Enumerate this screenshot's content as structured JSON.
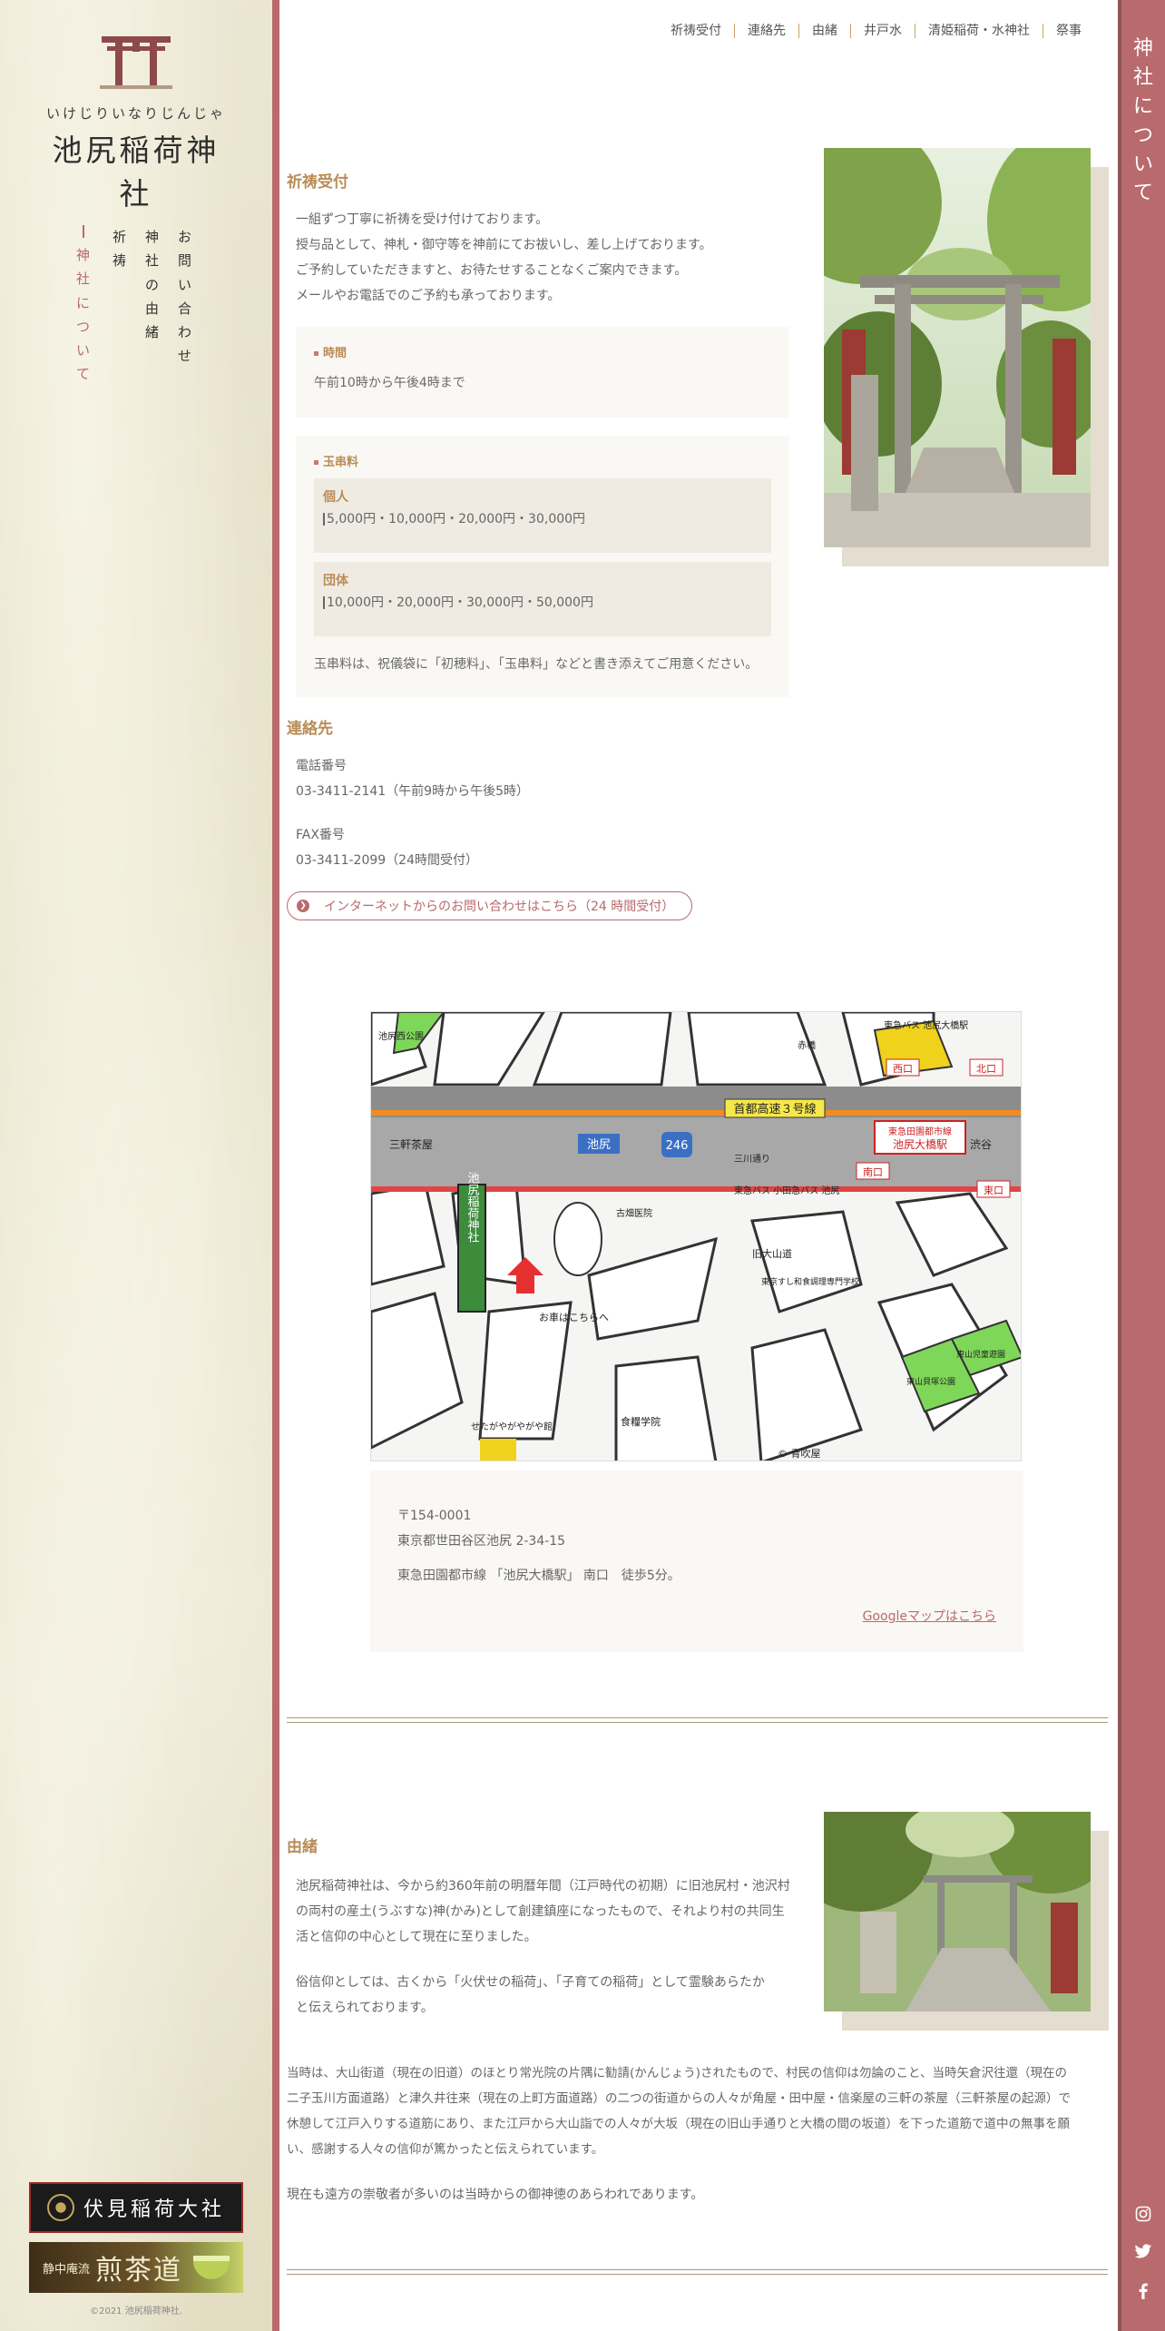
{
  "site": {
    "kana": "いけじりいなりじんじゃ",
    "name": "池尻稲荷神社",
    "copyright": "©2021 池尻稲荷神社."
  },
  "side_nav": [
    {
      "label": "お問い合わせ"
    },
    {
      "label": "神社の由緒"
    },
    {
      "label": "祈祷"
    },
    {
      "label": "神社について"
    }
  ],
  "banners": {
    "fushimi": "伏見稲荷大社",
    "sencha_small": "静中庵流",
    "sencha_big": "煎茶道"
  },
  "right_bar": {
    "title": "神社について"
  },
  "social": {
    "instagram": "instagram-icon",
    "twitter": "twitter-icon",
    "facebook": "facebook-icon"
  },
  "top_nav": [
    "祈祷受付",
    "連絡先",
    "由緒",
    "井戸水",
    "清姫稲荷・水神社",
    "祭事"
  ],
  "kito": {
    "title": "祈祷受付",
    "lines": [
      "一組ずつ丁寧に祈祷を受け付けております。",
      "授与品として、神札・御守等を神前にてお祓いし、差し上げております。",
      "ご予約していただきますと、お待たせすることなくご案内できます。",
      "メールやお電話でのご予約も承っております。"
    ],
    "time_label": "時間",
    "time_value": "午前10時から午後4時まで",
    "tama_label": "玉串料",
    "individual_label": "個人",
    "individual_value": "5,000円・10,000円・20,000円・30,000円",
    "group_label": "団体",
    "group_value": "10,000円・20,000円・30,000円・50,000円",
    "tama_note": "玉串料は、祝儀袋に「初穂料」、「玉串料」などと書き添えてご用意ください。"
  },
  "contact": {
    "title": "連絡先",
    "tel_label": "電話番号",
    "tel_value": "03-3411-2141（午前9時から午後5時）",
    "fax_label": "FAX番号",
    "fax_value": "03-3411-2099（24時間受付）",
    "button": "インターネットからのお問い合わせはこちら（24 時間受付）"
  },
  "map": {
    "labels": {
      "expressway": "首都高速３号線",
      "route": "246",
      "station": "池尻",
      "shrine": "池尻稲荷神社",
      "line": "東急田園都市線",
      "station_name": "池尻大橋駅",
      "bus": "東急バス 池尻大橋駅",
      "west": "西口",
      "north": "北口",
      "south": "南口",
      "east": "東口",
      "bus2": "東急バス 小田急バス 池尻",
      "sangenjaya": "三軒茶屋",
      "shibuya": "渋谷",
      "sangawa": "三川通り",
      "furukawa": "古畑医院",
      "kyu_oyama": "旧大山道",
      "school": "東京すし和食調理専門学校",
      "note": "お車はこちらへ",
      "park1": "池尻西公園",
      "park2": "東山貝塚公園",
      "park3": "東山児童遊園",
      "setagaya": "せたがやがやがや館",
      "shokuryo": "食糧学院",
      "akebashi": "赤橋",
      "copyright": "© 青吹屋"
    }
  },
  "address": {
    "postal": "〒154-0001",
    "street": "東京都世田谷区池尻 2-34-15",
    "access": "東急田園都市線 「池尻大橋駅」 南口　徒歩5分。",
    "map_link": "Googleマップはこちら"
  },
  "history": {
    "title": "由緒",
    "p1": [
      "池尻稲荷神社は、今から約360年前の明暦年間（江戸時代の初期）に旧池尻村・池沢村",
      "の両村の産土(うぶすな)神(かみ)として創建鎮座になったもので、それより村の共同生",
      "活と信仰の中心として現在に至りました。"
    ],
    "p2": [
      "俗信仰としては、古くから「火伏せの稲荷」、「子育ての稲荷」として霊験あらたか",
      "と伝えられております。"
    ],
    "p3": [
      "当時は、大山街道（現在の旧道）のほとり常光院の片隅に勧請(かんじょう)されたもので、村民の信仰は勿論のこと、当時矢倉沢往還（現在の",
      "二子玉川方面道路）と津久井往来（現在の上町方面道路）の二つの街道からの人々が角屋・田中屋・信楽屋の三軒の茶屋（三軒茶屋の起源）で",
      "休憩して江戸入りする道筋にあり、また江戸から大山詣での人々が大坂（現在の旧山手通りと大橋の間の坂道）を下った道筋で道中の無事を願",
      "い、感謝する人々の信仰が篤かったと伝えられています。"
    ],
    "p4": "現在も遠方の崇敬者が多いのは当時からの御神徳のあらわれであります。"
  },
  "colors": {
    "accent": "#b86a6d",
    "gold": "#b98c57",
    "panel": "#faf8f4"
  }
}
